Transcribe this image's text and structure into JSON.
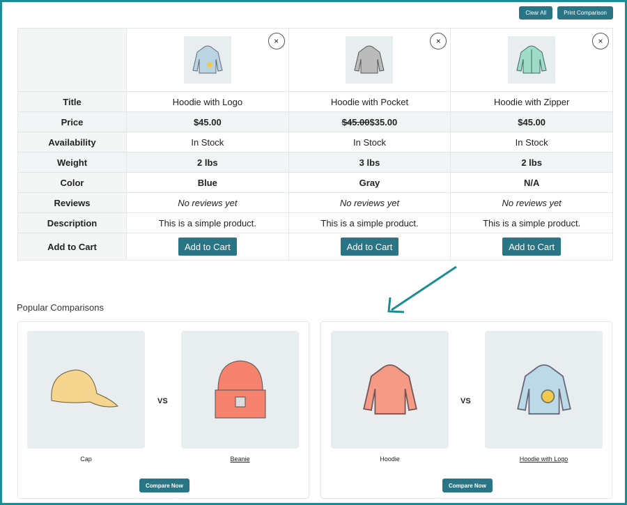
{
  "actions": {
    "clear_all": "Clear All",
    "print": "Print Comparison"
  },
  "compare": {
    "labels": [
      "Title",
      "Price",
      "Availability",
      "Weight",
      "Color",
      "Reviews",
      "Description",
      "Add to Cart"
    ],
    "products": [
      {
        "title": "Hoodie with Logo",
        "price_old": "",
        "price": "$45.00",
        "availability": "In Stock",
        "weight": "2 lbs",
        "color": "Blue",
        "reviews": "No reviews yet",
        "description": "This is a simple product.",
        "cart": "Add to Cart",
        "tint": "#b9d4e2"
      },
      {
        "title": "Hoodie with Pocket",
        "price_old": "$45.00",
        "price": "$35.00",
        "availability": "In Stock",
        "weight": "3 lbs",
        "color": "Gray",
        "reviews": "No reviews yet",
        "description": "This is a simple product.",
        "cart": "Add to Cart",
        "tint": "#b9b9b9"
      },
      {
        "title": "Hoodie with Zipper",
        "price_old": "",
        "price": "$45.00",
        "availability": "In Stock",
        "weight": "2 lbs",
        "color": "N/A",
        "reviews": "No reviews yet",
        "description": "This is a simple product.",
        "cart": "Add to Cart",
        "tint": "#9fdcc6"
      }
    ],
    "remove": "×"
  },
  "popular": {
    "title": "Popular Comparisons",
    "vs": "VS",
    "compare_now": "Compare Now",
    "pairs": [
      {
        "a": "Cap",
        "b": "Beanie"
      },
      {
        "a": "Hoodie",
        "b": "Hoodie with Logo"
      }
    ]
  }
}
